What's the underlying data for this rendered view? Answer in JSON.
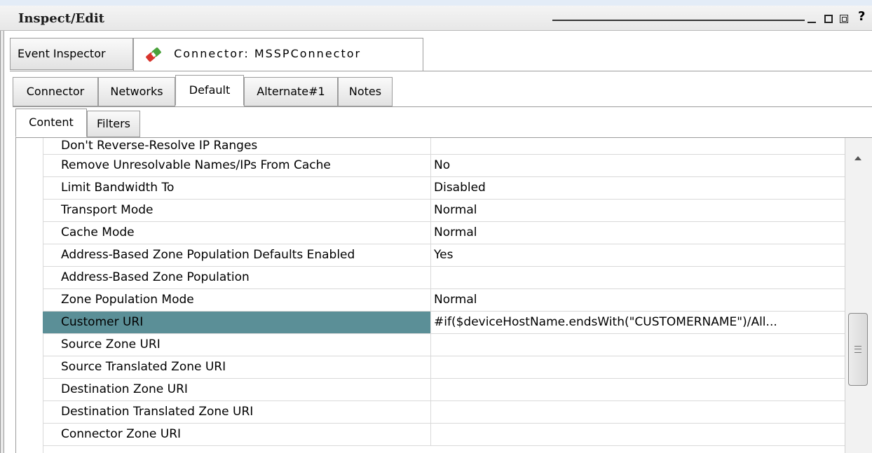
{
  "window": {
    "title": "Inspect/Edit",
    "help_label": "?"
  },
  "main_tabs": [
    {
      "label": "Event Inspector"
    },
    {
      "label": "Connector: MSSPConnector",
      "icon": "connector-icon"
    }
  ],
  "connector_tabs": [
    {
      "label": "Connector"
    },
    {
      "label": "Networks"
    },
    {
      "label": "Default"
    },
    {
      "label": "Alternate#1"
    },
    {
      "label": "Notes"
    }
  ],
  "content_tabs": [
    {
      "label": "Content"
    },
    {
      "label": "Filters"
    }
  ],
  "properties": [
    {
      "name": "Don't Reverse-Resolve IP Ranges",
      "value": ""
    },
    {
      "name": "Remove Unresolvable Names/IPs From Cache",
      "value": "No"
    },
    {
      "name": "Limit Bandwidth To",
      "value": "Disabled"
    },
    {
      "name": "Transport Mode",
      "value": "Normal"
    },
    {
      "name": "Cache Mode",
      "value": "Normal"
    },
    {
      "name": "Address-Based Zone Population Defaults Enabled",
      "value": "Yes"
    },
    {
      "name": "Address-Based Zone Population",
      "value": ""
    },
    {
      "name": "Zone Population Mode",
      "value": "Normal"
    },
    {
      "name": "Customer URI",
      "value": "#if($deviceHostName.endsWith(\"CUSTOMERNAME\")/All..."
    },
    {
      "name": "Source Zone URI",
      "value": ""
    },
    {
      "name": "Source Translated Zone URI",
      "value": ""
    },
    {
      "name": "Destination Zone URI",
      "value": ""
    },
    {
      "name": "Destination Translated Zone URI",
      "value": ""
    },
    {
      "name": "Connector Zone URI",
      "value": ""
    }
  ],
  "colors": {
    "selected_row": "#5b8f97",
    "tab_border": "#9c9c9c"
  }
}
